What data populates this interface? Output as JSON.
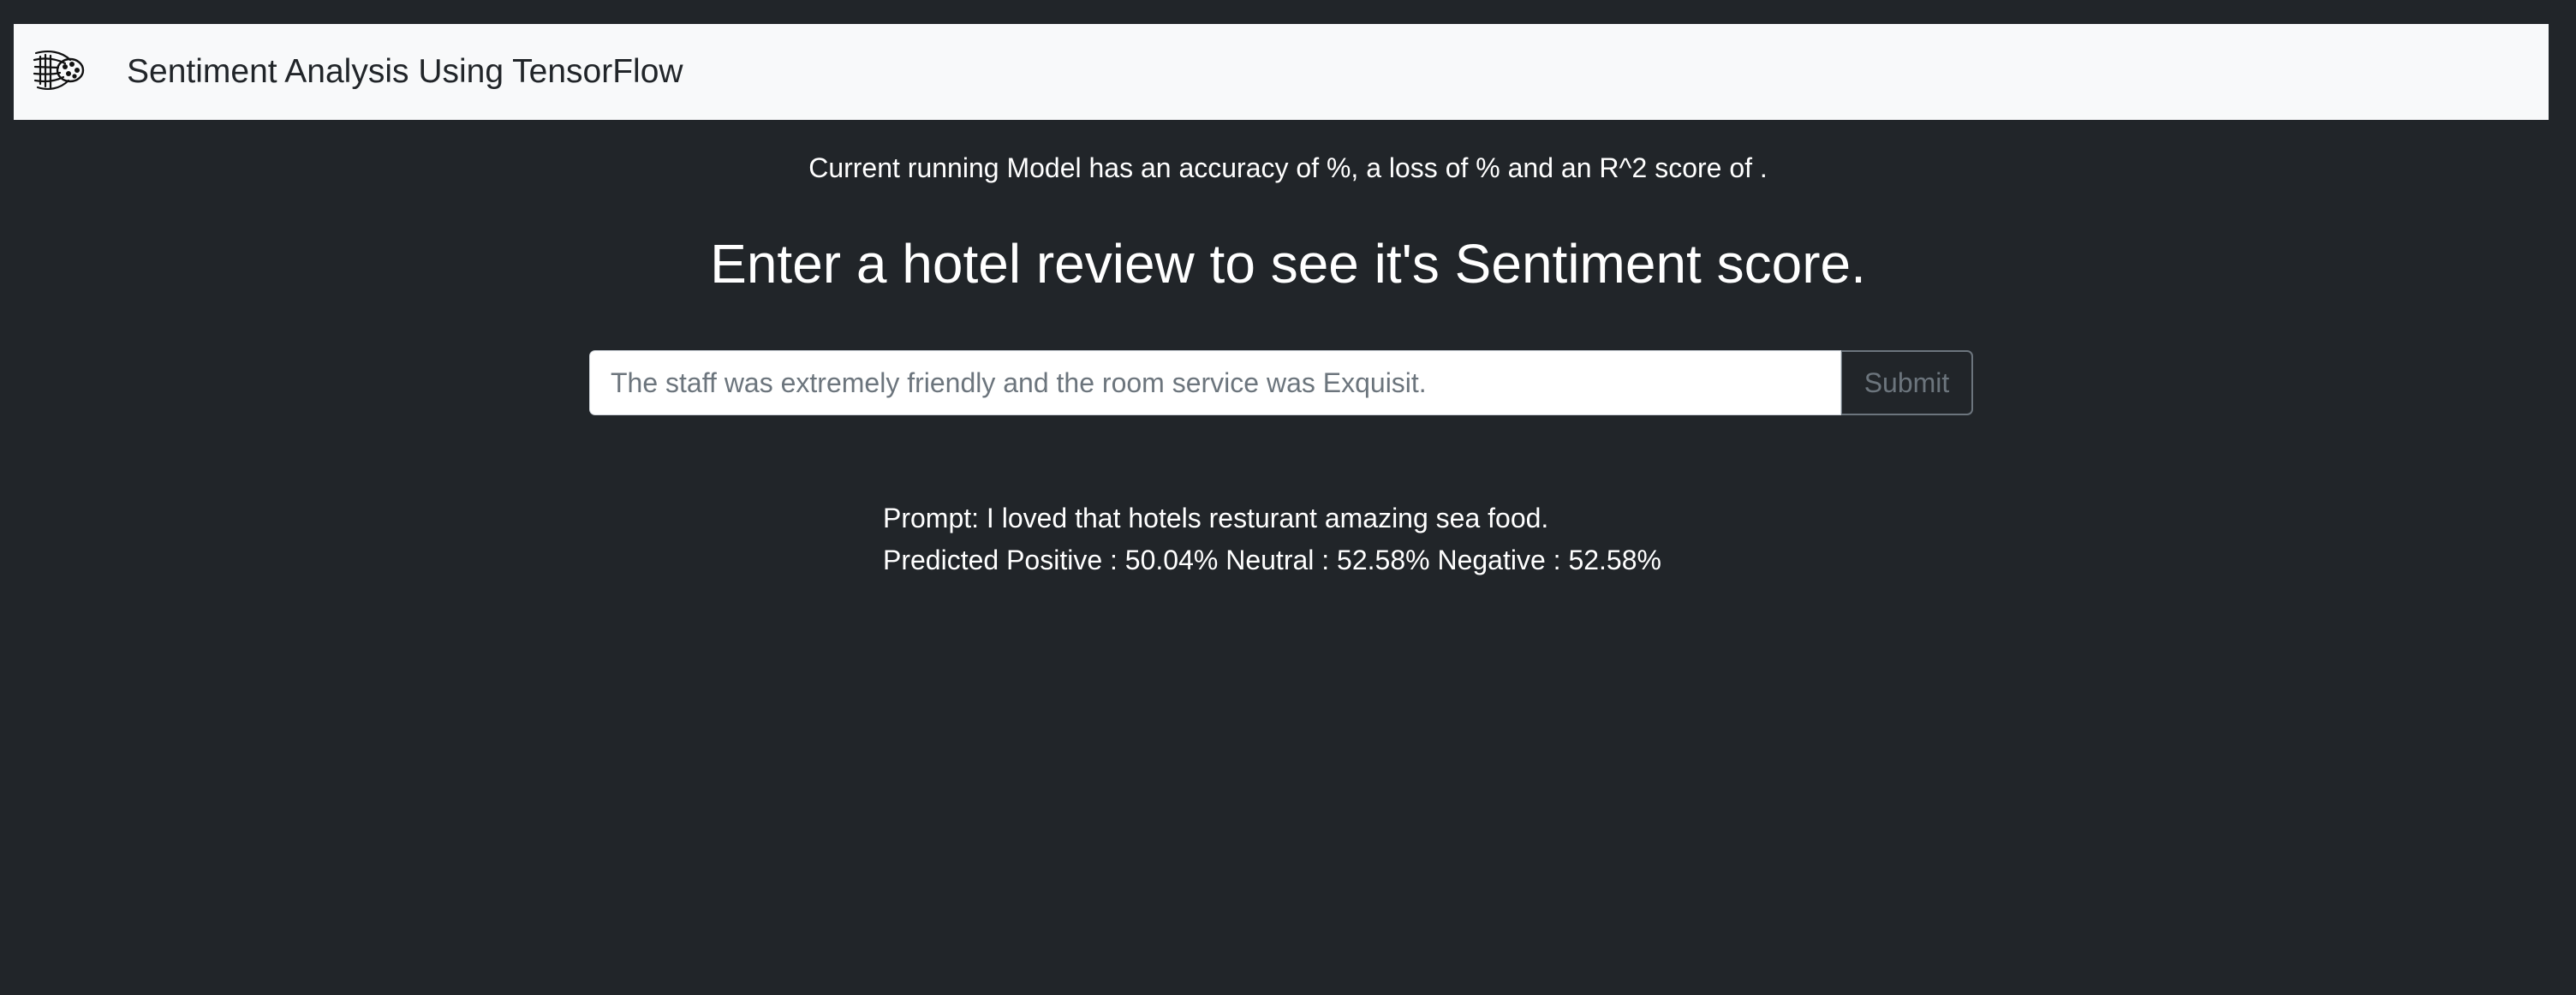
{
  "navbar": {
    "logo_icon": "tensorflow-fish-logo-icon",
    "title": "Sentiment Analysis Using TensorFlow"
  },
  "model_stats": {
    "text": "Current running Model has an accuracy of %, a loss of % and an R^2 score of ."
  },
  "headline": "Enter a hotel review to see it's Sentiment score.",
  "form": {
    "input_value": "",
    "input_placeholder": "The staff was extremely friendly and the room service was Exquisit.",
    "submit_label": "Submit"
  },
  "result": {
    "prompt_line": "Prompt: I loved that hotels resturant amazing sea food.",
    "prediction_line": "Predicted Positive : 50.04% Neutral : 52.58% Negative : 52.58%"
  },
  "colors": {
    "page_background": "#212529",
    "navbar_background": "#f8f9fa",
    "text": "#ffffff",
    "muted": "#6c757d"
  }
}
